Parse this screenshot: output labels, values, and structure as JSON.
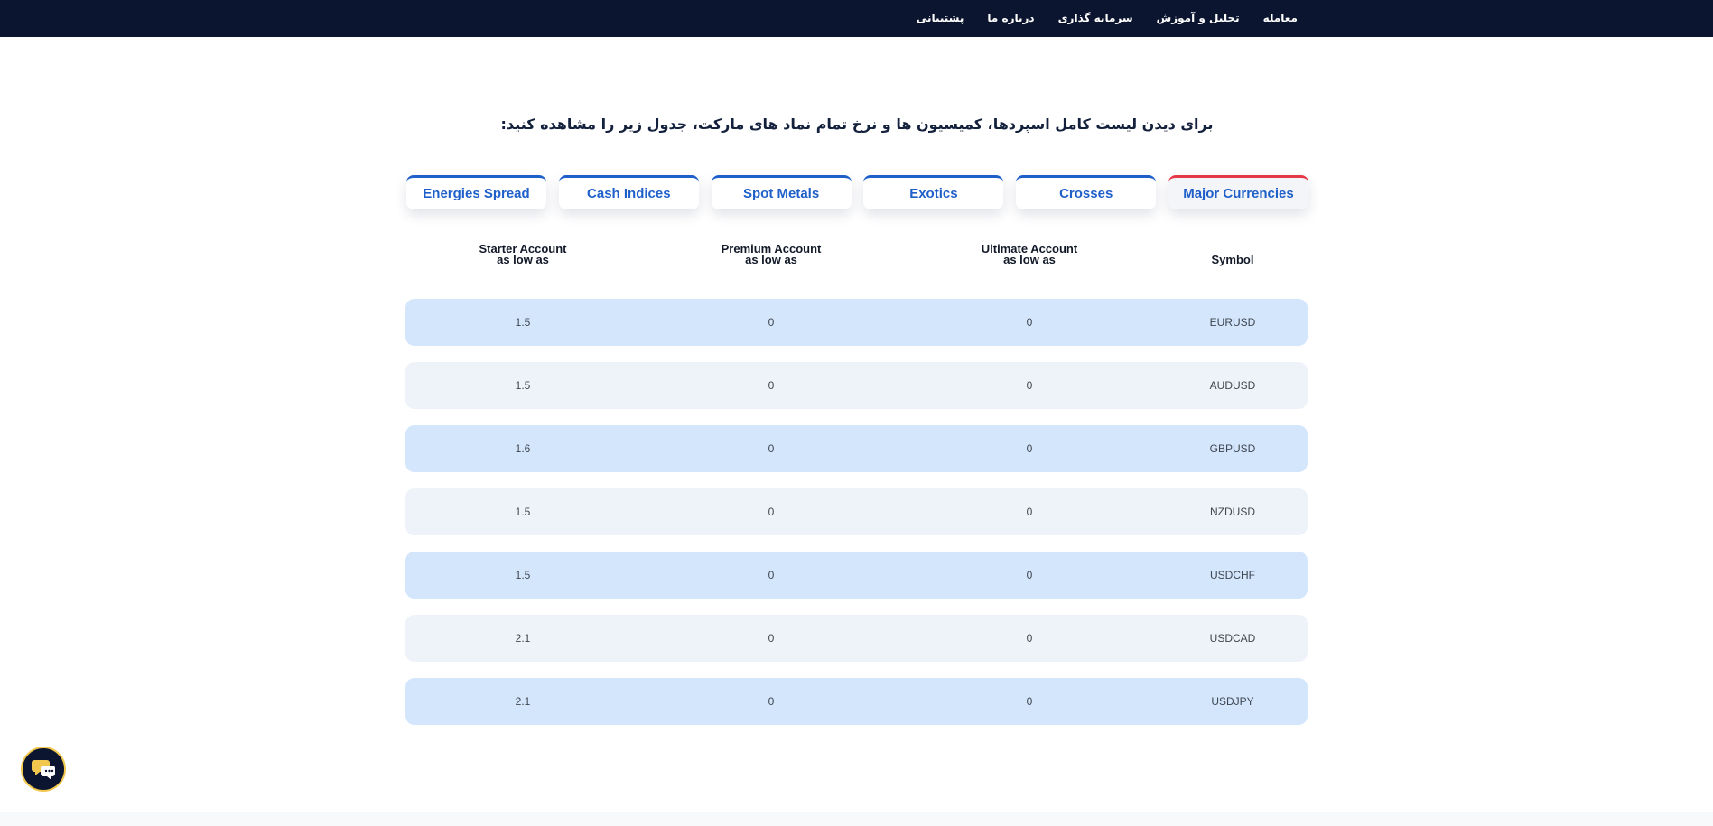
{
  "nav": {
    "items": [
      {
        "label": "معامله"
      },
      {
        "label": "تحلیل و آموزش"
      },
      {
        "label": "سرمایه گذاری"
      },
      {
        "label": "درباره ما"
      },
      {
        "label": "پشتیبانی"
      }
    ]
  },
  "heading": "برای دیدن لیست کامل اسپردها، کمیسیون ها و نرخ تمام نماد های مارکت، جدول زیر را مشاهده کنید:",
  "tabs": [
    {
      "label": "Major Currencies",
      "active": true
    },
    {
      "label": "Crosses"
    },
    {
      "label": "Exotics"
    },
    {
      "label": "Spot Metals"
    },
    {
      "label": "Cash Indices"
    },
    {
      "label": "Energies Spread"
    }
  ],
  "table": {
    "headers": {
      "symbol": "Symbol",
      "ultimate": "Ultimate Account",
      "ultimate_sub": "as low as",
      "premium": "Premium Account",
      "premium_sub": "as low as",
      "starter": "Starter Account",
      "starter_sub": "as low as"
    },
    "rows": [
      {
        "symbol": "EURUSD",
        "ultimate": "0",
        "premium": "0",
        "starter": "1.5"
      },
      {
        "symbol": "AUDUSD",
        "ultimate": "0",
        "premium": "0",
        "starter": "1.5"
      },
      {
        "symbol": "GBPUSD",
        "ultimate": "0",
        "premium": "0",
        "starter": "1.6"
      },
      {
        "symbol": "NZDUSD",
        "ultimate": "0",
        "premium": "0",
        "starter": "1.5"
      },
      {
        "symbol": "USDCHF",
        "ultimate": "0",
        "premium": "0",
        "starter": "1.5"
      },
      {
        "symbol": "USDCAD",
        "ultimate": "0",
        "premium": "0",
        "starter": "2.1"
      },
      {
        "symbol": "USDJPY",
        "ultimate": "0",
        "premium": "0",
        "starter": "2.1"
      }
    ]
  },
  "colors": {
    "topbar": "#0c1530",
    "tab_accent": "#1f5fc9",
    "tab_active_accent": "#e63946",
    "row_highlight": "#d4e6fc",
    "row_plain": "#eef3f9",
    "chat_ring": "#f2c74e"
  },
  "icons": {
    "chat": "chat-bubbles-icon"
  }
}
